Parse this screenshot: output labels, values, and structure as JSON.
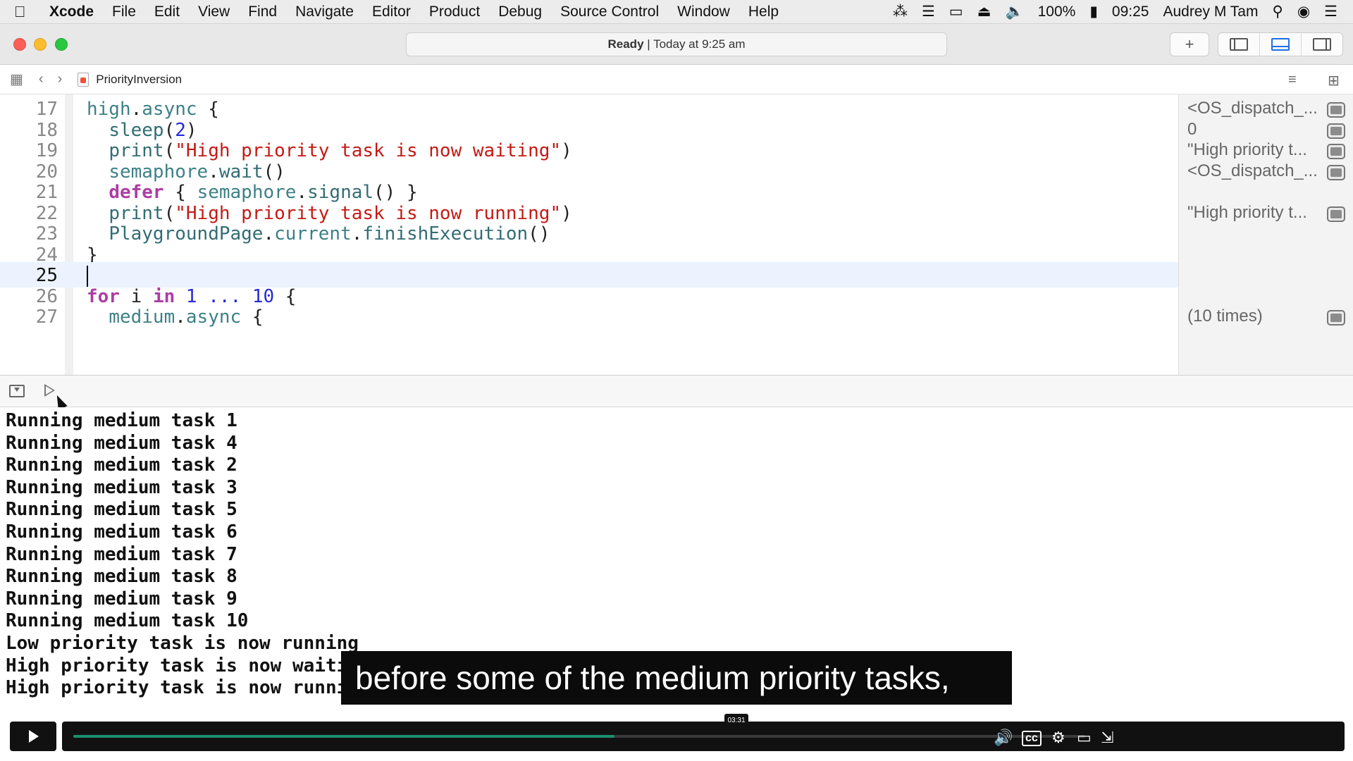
{
  "menubar": {
    "app_name": "Xcode",
    "items": [
      "File",
      "Edit",
      "View",
      "Find",
      "Navigate",
      "Editor",
      "Product",
      "Debug",
      "Source Control",
      "Window",
      "Help"
    ],
    "battery": "100%",
    "clock": "09:25",
    "user": "Audrey M Tam"
  },
  "window": {
    "status_strong": "Ready",
    "status_rest": " | Today at 9:25 am",
    "file_name": "PriorityInversion"
  },
  "editor": {
    "lines": [
      {
        "num": "17",
        "tokens": [
          {
            "t": "high",
            "c": "id"
          },
          {
            "t": ".",
            "c": "plain"
          },
          {
            "t": "async",
            "c": "id"
          },
          {
            "t": " {",
            "c": "plain"
          }
        ]
      },
      {
        "num": "18",
        "tokens": [
          {
            "t": "  ",
            "c": "plain"
          },
          {
            "t": "sleep",
            "c": "fn"
          },
          {
            "t": "(",
            "c": "plain"
          },
          {
            "t": "2",
            "c": "num"
          },
          {
            "t": ")",
            "c": "plain"
          }
        ]
      },
      {
        "num": "19",
        "tokens": [
          {
            "t": "  ",
            "c": "plain"
          },
          {
            "t": "print",
            "c": "fn"
          },
          {
            "t": "(",
            "c": "plain"
          },
          {
            "t": "\"High priority task is now waiting\"",
            "c": "str"
          },
          {
            "t": ")",
            "c": "plain"
          }
        ]
      },
      {
        "num": "20",
        "tokens": [
          {
            "t": "  ",
            "c": "plain"
          },
          {
            "t": "semaphore",
            "c": "id"
          },
          {
            "t": ".",
            "c": "plain"
          },
          {
            "t": "wait",
            "c": "fn"
          },
          {
            "t": "()",
            "c": "plain"
          }
        ]
      },
      {
        "num": "21",
        "tokens": [
          {
            "t": "  ",
            "c": "plain"
          },
          {
            "t": "defer",
            "c": "kw"
          },
          {
            "t": " { ",
            "c": "plain"
          },
          {
            "t": "semaphore",
            "c": "id"
          },
          {
            "t": ".",
            "c": "plain"
          },
          {
            "t": "signal",
            "c": "fn"
          },
          {
            "t": "() }",
            "c": "plain"
          }
        ]
      },
      {
        "num": "22",
        "tokens": [
          {
            "t": "  ",
            "c": "plain"
          },
          {
            "t": "print",
            "c": "fn"
          },
          {
            "t": "(",
            "c": "plain"
          },
          {
            "t": "\"High priority task is now running\"",
            "c": "str"
          },
          {
            "t": ")",
            "c": "plain"
          }
        ]
      },
      {
        "num": "23",
        "tokens": [
          {
            "t": "  ",
            "c": "plain"
          },
          {
            "t": "PlaygroundPage",
            "c": "fn"
          },
          {
            "t": ".",
            "c": "plain"
          },
          {
            "t": "current",
            "c": "id"
          },
          {
            "t": ".",
            "c": "plain"
          },
          {
            "t": "finishExecution",
            "c": "fn"
          },
          {
            "t": "()",
            "c": "plain"
          }
        ]
      },
      {
        "num": "24",
        "tokens": [
          {
            "t": "}",
            "c": "plain"
          }
        ]
      },
      {
        "num": "25",
        "tokens": [],
        "current": true
      },
      {
        "num": "26",
        "tokens": [
          {
            "t": "for",
            "c": "kw"
          },
          {
            "t": " i ",
            "c": "plain"
          },
          {
            "t": "in",
            "c": "kw"
          },
          {
            "t": " ",
            "c": "plain"
          },
          {
            "t": "1",
            "c": "num"
          },
          {
            "t": " ... ",
            "c": "num"
          },
          {
            "t": "10",
            "c": "num"
          },
          {
            "t": " {",
            "c": "plain"
          }
        ]
      },
      {
        "num": "27",
        "tokens": [
          {
            "t": "  ",
            "c": "plain"
          },
          {
            "t": "medium",
            "c": "id"
          },
          {
            "t": ".",
            "c": "plain"
          },
          {
            "t": "async",
            "c": "id"
          },
          {
            "t": " {",
            "c": "plain"
          }
        ]
      }
    ]
  },
  "results": [
    {
      "line": 0,
      "value": "<OS_dispatch_..."
    },
    {
      "line": 1,
      "value": "0"
    },
    {
      "line": 2,
      "value": "\"High priority t..."
    },
    {
      "line": 3,
      "value": "<OS_dispatch_..."
    },
    {
      "line": 5,
      "value": "\"High priority t..."
    },
    {
      "line": 10,
      "value": "(10 times)"
    }
  ],
  "console": [
    "Running medium task 1",
    "Running medium task 4",
    "Running medium task 2",
    "Running medium task 3",
    "Running medium task 5",
    "Running medium task 6",
    "Running medium task 7",
    "Running medium task 8",
    "Running medium task 9",
    "Running medium task 10",
    "Low priority task is now running",
    "High priority task is now waiting",
    "High priority task is now running"
  ],
  "caption": "before some of the medium priority tasks,",
  "player": {
    "timecode": "03:31",
    "progress": 0.535
  }
}
